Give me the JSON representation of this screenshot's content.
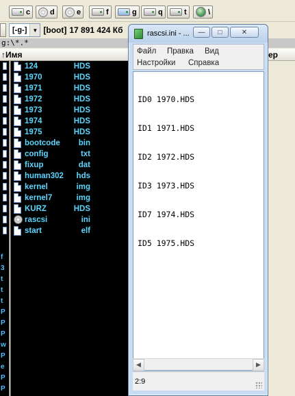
{
  "drives": [
    {
      "letter": "c",
      "icon": "hard-drive-icon"
    },
    {
      "letter": "d",
      "icon": "cd-drive-icon"
    },
    {
      "letter": "e",
      "icon": "cd-drive-icon"
    },
    {
      "letter": "f",
      "icon": "hard-drive-icon"
    },
    {
      "letter": "g",
      "icon": "network-drive-icon"
    },
    {
      "letter": "q",
      "icon": "hard-drive-icon"
    },
    {
      "letter": "t",
      "icon": "hard-drive-icon"
    },
    {
      "letter": "\\",
      "icon": "network-globe-icon"
    }
  ],
  "panel": {
    "drive_combo": "[-g-]",
    "volume_label": "[boot]",
    "free_space": "17 891 424 Кб",
    "current_path": "g:\\*.*",
    "column_name": "↑Имя",
    "right_column_stub": "ер",
    "left_sliver_letters": [
      "f",
      "3",
      "t",
      "t",
      "t",
      "P",
      "P",
      "P",
      "w",
      "P",
      "e",
      "P",
      "P",
      "P"
    ]
  },
  "files": [
    {
      "name": "124",
      "ext": "HDS",
      "icon": "file-icon"
    },
    {
      "name": "1970",
      "ext": "HDS",
      "icon": "file-icon"
    },
    {
      "name": "1971",
      "ext": "HDS",
      "icon": "file-icon"
    },
    {
      "name": "1972",
      "ext": "HDS",
      "icon": "file-icon"
    },
    {
      "name": "1973",
      "ext": "HDS",
      "icon": "file-icon"
    },
    {
      "name": "1974",
      "ext": "HDS",
      "icon": "file-icon"
    },
    {
      "name": "1975",
      "ext": "HDS",
      "icon": "file-icon"
    },
    {
      "name": "bootcode",
      "ext": "bin",
      "icon": "file-icon"
    },
    {
      "name": "config",
      "ext": "txt",
      "icon": "file-icon"
    },
    {
      "name": "fixup",
      "ext": "dat",
      "icon": "file-icon"
    },
    {
      "name": "human302",
      "ext": "hds",
      "icon": "file-icon"
    },
    {
      "name": "kernel",
      "ext": "img",
      "icon": "file-icon"
    },
    {
      "name": "kernel7",
      "ext": "img",
      "icon": "file-icon"
    },
    {
      "name": "KURZ",
      "ext": "HDS",
      "icon": "file-icon"
    },
    {
      "name": "rascsi",
      "ext": "ini",
      "icon": "settings-file-icon"
    },
    {
      "name": "start",
      "ext": "elf",
      "icon": "file-icon"
    }
  ],
  "notepad": {
    "title": "rascsi.ini - ...",
    "menu": {
      "file": "Файл",
      "edit": "Правка",
      "view": "Вид",
      "settings": "Настройки",
      "help": "Справка"
    },
    "content_lines": [
      "ID0 1970.HDS",
      "ID1 1971.HDS",
      "ID2 1972.HDS",
      "ID3 1973.HDS",
      "ID7 1974.HDS",
      "ID5 1975.HDS"
    ],
    "status": "2:9"
  }
}
